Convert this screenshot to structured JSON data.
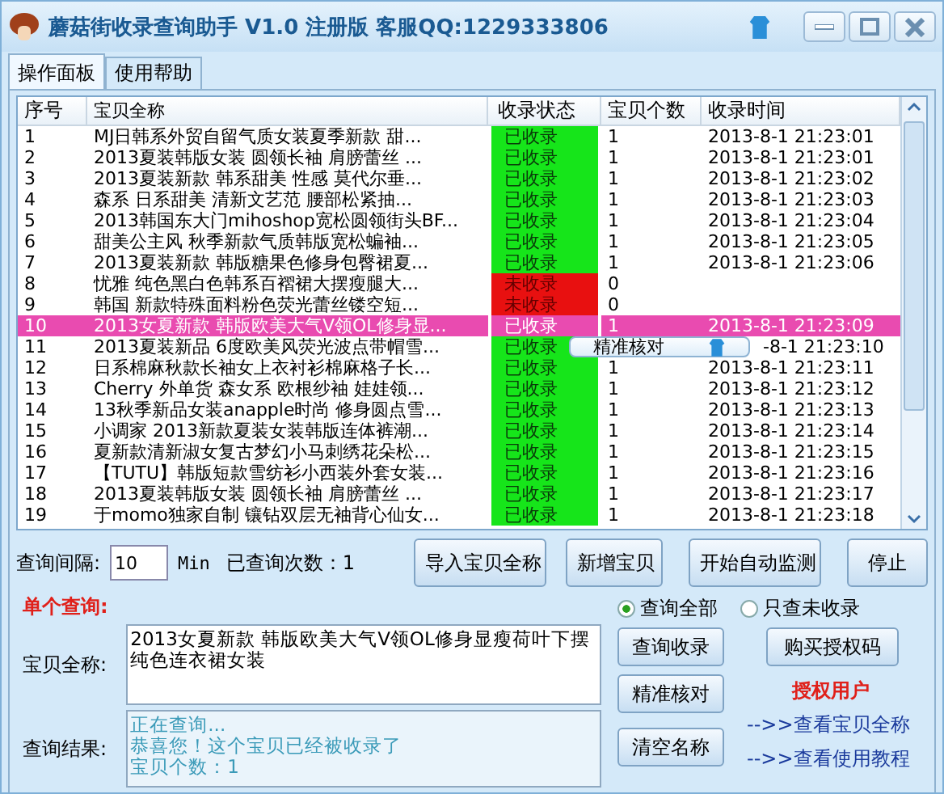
{
  "window": {
    "title": "蘑菇街收录查询助手 V1.0 注册版  客服QQ:1229333806"
  },
  "tabs": [
    {
      "label": "操作面板",
      "selected": true
    },
    {
      "label": "使用帮助",
      "selected": false
    }
  ],
  "table": {
    "columns": [
      "序号",
      "宝贝全称",
      "收录状态",
      "宝贝个数",
      "收录时间"
    ],
    "rows": [
      {
        "no": "1",
        "name": "MJ日韩系外贸自留气质女装夏季新款 甜...",
        "status": "已收录",
        "indexed": true,
        "count": "1",
        "time": "2013-8-1 21:23:01",
        "selected": false
      },
      {
        "no": "2",
        "name": "2013夏装韩版女装 圆领长袖 肩膀蕾丝 ...",
        "status": "已收录",
        "indexed": true,
        "count": "1",
        "time": "2013-8-1 21:23:01",
        "selected": false
      },
      {
        "no": "3",
        "name": "2013夏装新款 韩系甜美 性感 莫代尔垂...",
        "status": "已收录",
        "indexed": true,
        "count": "1",
        "time": "2013-8-1 21:23:02",
        "selected": false
      },
      {
        "no": "4",
        "name": "森系 日系甜美 清新文艺范 腰部松紧抽...",
        "status": "已收录",
        "indexed": true,
        "count": "1",
        "time": "2013-8-1 21:23:03",
        "selected": false
      },
      {
        "no": "5",
        "name": "2013韩国东大门mihoshop宽松圆领街头BF...",
        "status": "已收录",
        "indexed": true,
        "count": "1",
        "time": "2013-8-1 21:23:04",
        "selected": false
      },
      {
        "no": "6",
        "name": "甜美公主风 秋季新款气质韩版宽松蝙袖...",
        "status": "已收录",
        "indexed": true,
        "count": "1",
        "time": "2013-8-1 21:23:05",
        "selected": false
      },
      {
        "no": "7",
        "name": "2013夏装新款 韩版糖果色修身包臀裙夏...",
        "status": "已收录",
        "indexed": true,
        "count": "1",
        "time": "2013-8-1 21:23:06",
        "selected": false
      },
      {
        "no": "8",
        "name": "忧雅 纯色黑白色韩系百褶裙大摆瘦腿大...",
        "status": "未收录",
        "indexed": false,
        "count": "0",
        "selected": false
      },
      {
        "no": "9",
        "name": "韩国 新款特殊面料粉色荧光蕾丝镂空短...",
        "status": "未收录",
        "indexed": false,
        "count": "0",
        "selected": false
      },
      {
        "no": "10",
        "name": "2013女夏新款 韩版欧美大气V领OL修身显...",
        "status": "已收录",
        "indexed": true,
        "count": "1",
        "time": "2013-8-1 21:23:09",
        "selected": true
      },
      {
        "no": "11",
        "name": "2013夏装新品 6度欧美风荧光波点带帽雪...",
        "status": "已收录",
        "indexed": true,
        "time": "-8-1 21:23:10",
        "selected": false,
        "under_menu": true
      },
      {
        "no": "12",
        "name": "日系棉麻秋款长袖女上衣衬衫棉麻格子长...",
        "status": "已收录",
        "indexed": true,
        "count": "1",
        "time": "2013-8-1 21:23:11",
        "selected": false
      },
      {
        "no": "13",
        "name": "Cherry 外单货 森女系 欧根纱袖 娃娃领...",
        "status": "已收录",
        "indexed": true,
        "count": "1",
        "time": "2013-8-1 21:23:12",
        "selected": false
      },
      {
        "no": "14",
        "name": "13秋季新品女装anapple时尚 修身圆点雪...",
        "status": "已收录",
        "indexed": true,
        "count": "1",
        "time": "2013-8-1 21:23:13",
        "selected": false
      },
      {
        "no": "15",
        "name": "小调家 2013新款夏装女装韩版连体裤潮...",
        "status": "已收录",
        "indexed": true,
        "count": "1",
        "time": "2013-8-1 21:23:14",
        "selected": false
      },
      {
        "no": "16",
        "name": "夏新款清新淑女复古梦幻小马刺绣花朵松...",
        "status": "已收录",
        "indexed": true,
        "count": "1",
        "time": "2013-8-1 21:23:15",
        "selected": false
      },
      {
        "no": "17",
        "name": "【TUTU】韩版短款雪纺衫小西装外套女装...",
        "status": "已收录",
        "indexed": true,
        "count": "1",
        "time": "2013-8-1 21:23:16",
        "selected": false
      },
      {
        "no": "18",
        "name": "2013夏装韩版女装 圆领长袖 肩膀蕾丝 ...",
        "status": "已收录",
        "indexed": true,
        "count": "1",
        "time": "2013-8-1 21:23:17",
        "selected": false
      },
      {
        "no": "19",
        "name": "于momo独家自制 镶钻双层无袖背心仙女...",
        "status": "已收录",
        "indexed": true,
        "count": "1",
        "time": "2013-8-1 21:23:18",
        "selected": false
      }
    ]
  },
  "context_menu": {
    "item": "精准核对"
  },
  "monitor": {
    "interval_label": "查询间隔:",
    "interval": "10",
    "unit": "Min",
    "count_label": "已查询次数：1",
    "buttons": [
      "导入宝贝全称",
      "新增宝贝",
      "开始自动监测",
      "停止"
    ]
  },
  "single_query": {
    "heading": "单个查询:",
    "options": [
      {
        "label": "查询全部",
        "selected": true
      },
      {
        "label": "只查未收录",
        "selected": false
      }
    ],
    "name_label": "宝贝全称:",
    "name_value": "2013女夏新款 韩版欧美大气V领OL修身显瘦荷叶下摆纯色连衣裙女装",
    "result_label": "查询结果:",
    "result_lines": [
      "正在查询...",
      "恭喜您！这个宝贝已经被收录了",
      "宝贝个数：1"
    ],
    "buttons": [
      "查询收录",
      "购买授权码",
      "精准核对",
      "清空名称"
    ],
    "license": "授权用户",
    "links": [
      "-->>查看宝贝全称",
      "-->>查看使用教程"
    ]
  }
}
